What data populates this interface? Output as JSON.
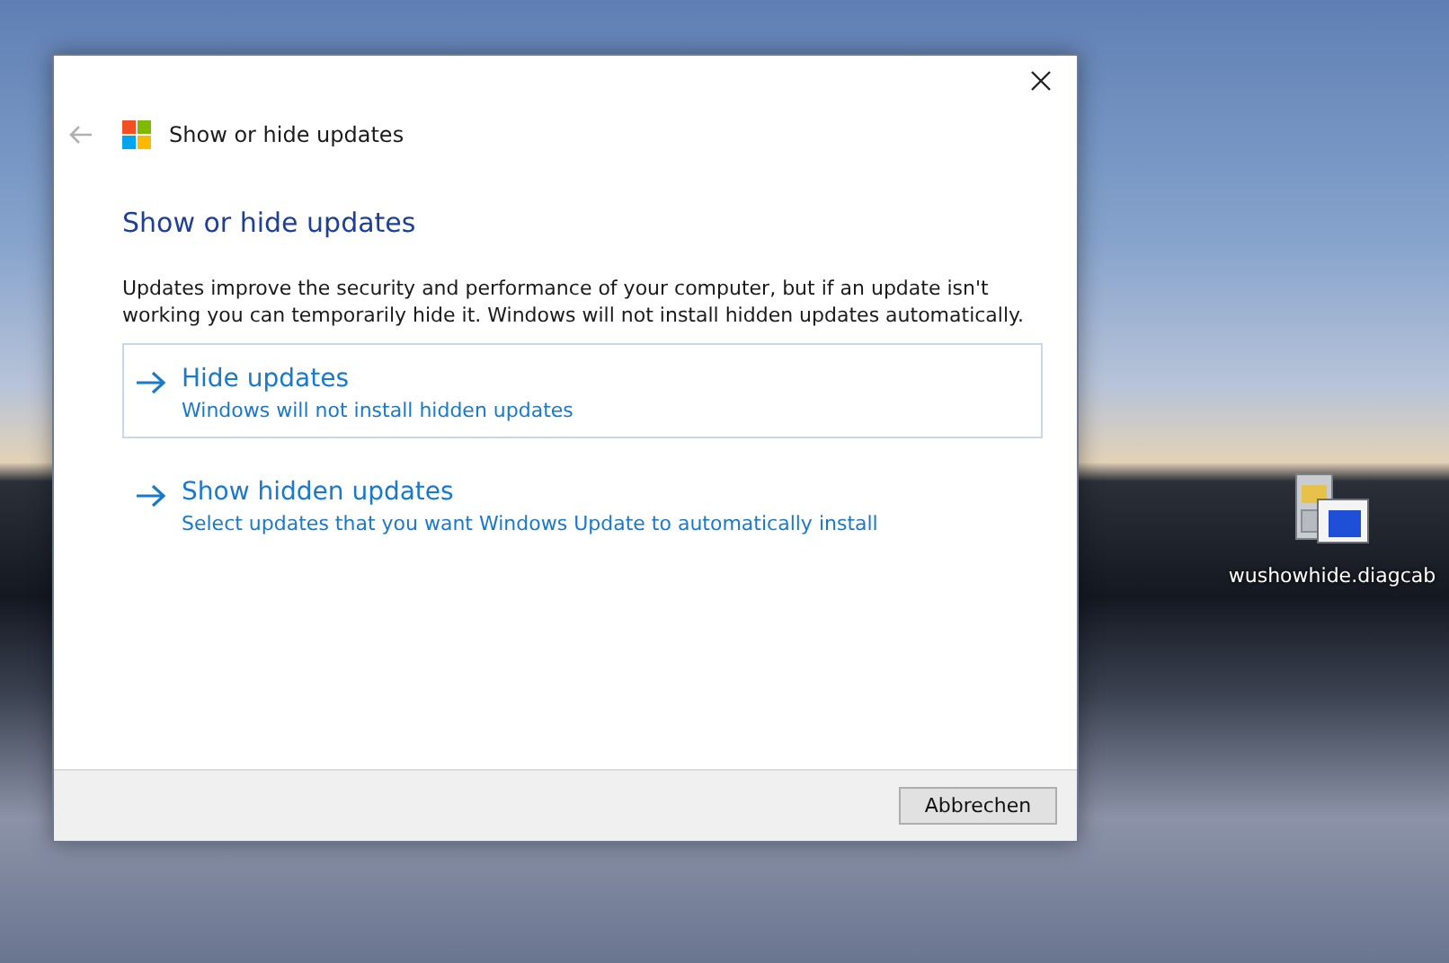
{
  "window": {
    "title": "Show or hide updates"
  },
  "heading": "Show or hide updates",
  "description": "Updates improve the security and performance of your computer, but if an update isn't working you can temporarily hide it. Windows will not install hidden updates automatically.",
  "options": [
    {
      "title": "Hide updates",
      "subtitle": "Windows will not install hidden updates",
      "selected": true
    },
    {
      "title": "Show hidden updates",
      "subtitle": "Select updates that you want Windows Update to automatically install",
      "selected": false
    }
  ],
  "buttons": [
    "Abbrechen"
  ],
  "desktop_icon": {
    "label": "wushowhide.diagcab"
  }
}
